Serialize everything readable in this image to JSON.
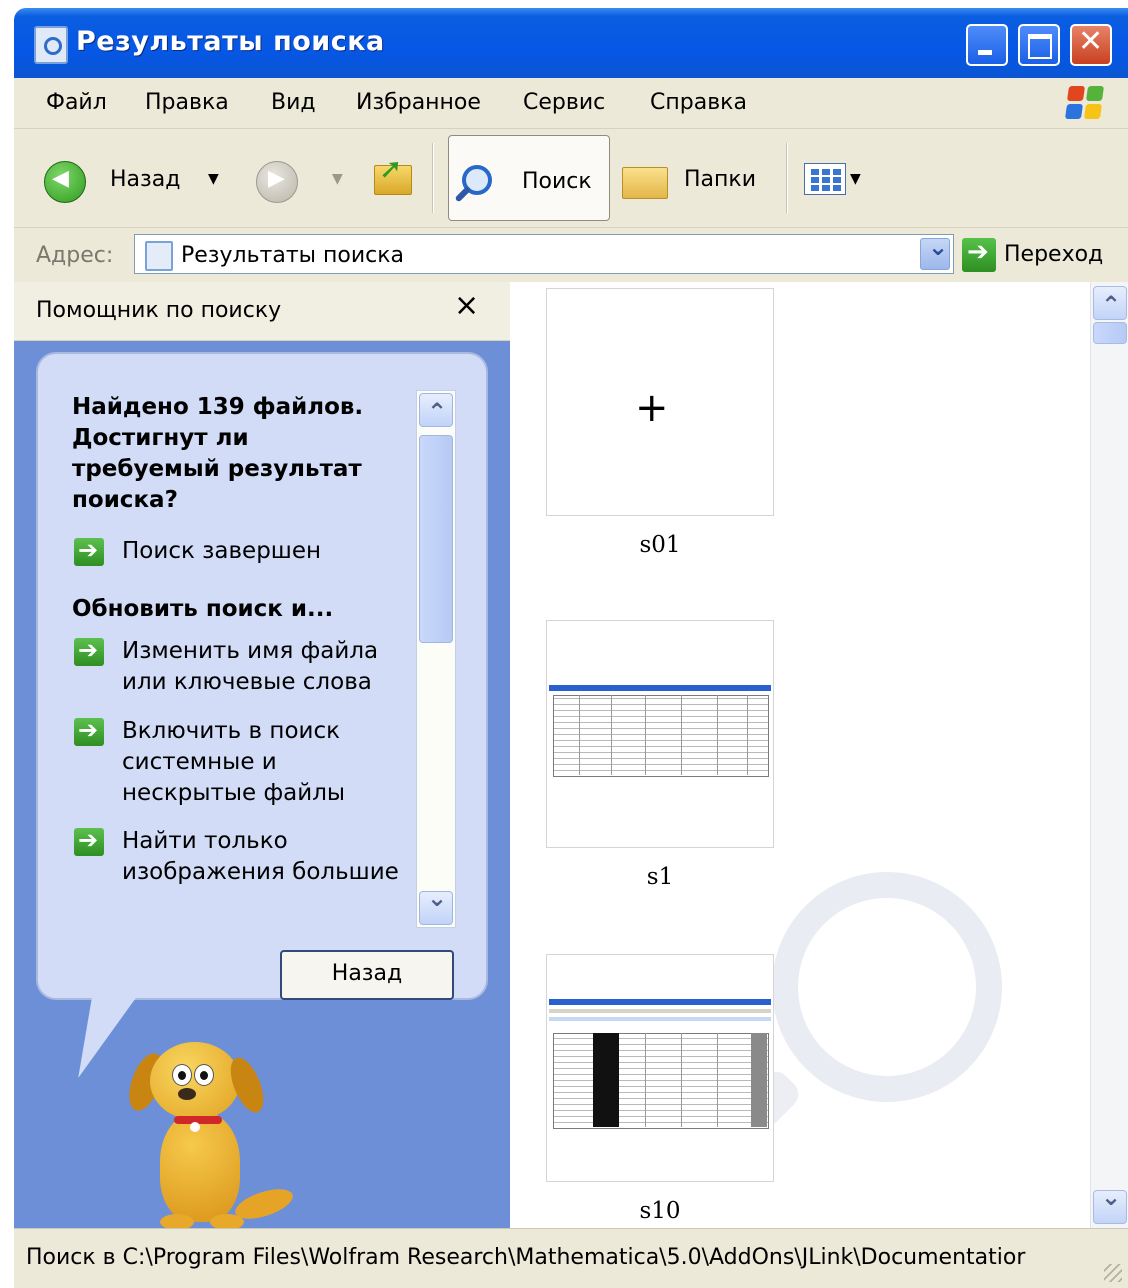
{
  "window": {
    "title": "Результаты поиска"
  },
  "menu": {
    "items": [
      "Файл",
      "Правка",
      "Вид",
      "Избранное",
      "Сервис",
      "Справка"
    ]
  },
  "toolbar": {
    "back_label": "Назад",
    "search_label": "Поиск",
    "folders_label": "Папки"
  },
  "address": {
    "label": "Адрес:",
    "value": "Результаты поиска",
    "go_label": "Переход"
  },
  "search_pane": {
    "title": "Помощник по поиску",
    "close_glyph": "×",
    "heading": "Найдено 139 файлов. Достигнут ли требуемый результат поиска?",
    "heading_lines": [
      "Найдено 139 файлов.",
      "Достигнут ли",
      "требуемый результат",
      "поиска?"
    ],
    "done_link": "Поиск завершен",
    "refine_heading": "Обновить поиск и...",
    "links": [
      {
        "lines": [
          "Изменить имя файла",
          "или ключевые слова"
        ]
      },
      {
        "lines": [
          "Включить в поиск",
          "системные и",
          "нескрытые файлы"
        ]
      },
      {
        "lines": [
          "Найти только",
          "изображения большие"
        ]
      }
    ],
    "back_button": "Назад"
  },
  "results": {
    "items": [
      {
        "name": "s01"
      },
      {
        "name": "s1"
      },
      {
        "name": "s10"
      }
    ]
  },
  "statusbar": {
    "text": "Поиск в C:\\Program Files\\Wolfram Research\\Mathematica\\5.0\\AddOns\\JLink\\Documentatior"
  },
  "colors": {
    "title_bar": "#0657e6",
    "chrome": "#ece9d8",
    "pane_background": "#6c8fd8",
    "balloon": "#d2dcf6",
    "go_green": "#2e8f22"
  }
}
